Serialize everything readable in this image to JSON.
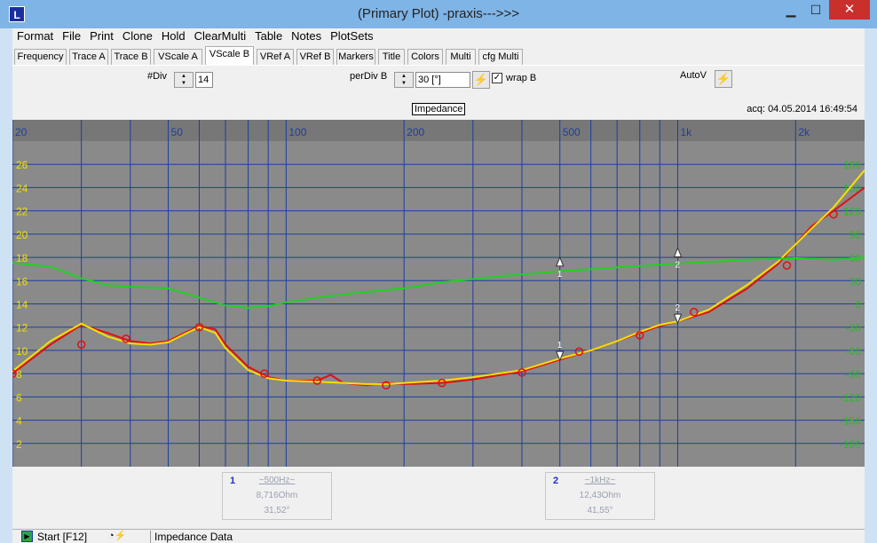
{
  "window": {
    "title": "(Primary Plot) -praxis--->>>",
    "app_icon_glyph": "L",
    "minimize_glyph": "▁",
    "maximize_glyph": "☐",
    "close_glyph": "✕"
  },
  "menu": [
    "Format",
    "File",
    "Print",
    "Clone",
    "Hold",
    "ClearMulti",
    "Table",
    "Notes",
    "PlotSets"
  ],
  "tabs": [
    "Frequency",
    "Trace A",
    "Trace B",
    "VScale A",
    "VScale B",
    "VRef A",
    "VRef B",
    "Markers",
    "Title",
    "Colors",
    "Multi",
    "cfg Multi"
  ],
  "active_tab": "VScale B",
  "controls": {
    "div_label": "#Div",
    "div_value": "14",
    "perdiv_label": "perDiv B",
    "perdiv_value": "30 [°]",
    "wrap_label": "wrap B",
    "wrap_checked": "✓",
    "autov_label": "AutoV",
    "apply_icon": "lightning-icon"
  },
  "plot": {
    "title": "Impedance",
    "acq": "acq: 04.05.2014 16:49:54",
    "bg": "#8a8a8a",
    "grid_color": "#1c3ea0"
  },
  "chart_data": {
    "type": "line",
    "x_scale": "log",
    "xlim": [
      20,
      3000
    ],
    "x_ticks": [
      {
        "v": 20,
        "label": "20"
      },
      {
        "v": 50,
        "label": "50"
      },
      {
        "v": 100,
        "label": "100"
      },
      {
        "v": 200,
        "label": "200"
      },
      {
        "v": 500,
        "label": "500"
      },
      {
        "v": 1000,
        "label": "1k"
      },
      {
        "v": 2000,
        "label": "2k"
      }
    ],
    "y_left": {
      "range": [
        0,
        28
      ],
      "labels": [
        2,
        4,
        6,
        8,
        10,
        12,
        14,
        16,
        18,
        20,
        22,
        24,
        26
      ],
      "color": "#f0e000"
    },
    "y_right": {
      "range": [
        -210,
        210
      ],
      "labels": [
        -180,
        -150,
        -120,
        -90,
        -60,
        -30,
        0,
        30,
        60,
        90,
        120,
        150,
        180
      ],
      "color": "#2db52d"
    },
    "series": [
      {
        "color": "#e01010",
        "axis": "left",
        "x": [
          20,
          25,
          30,
          35,
          40,
          45,
          50,
          55,
          60,
          66,
          70,
          80,
          90,
          100,
          120,
          130,
          140,
          160,
          180,
          200,
          250,
          300,
          400,
          500,
          600,
          700,
          800,
          900,
          1000,
          1200,
          1500,
          1800,
          2200,
          2500,
          3000
        ],
        "y": [
          8.0,
          10.5,
          12.2,
          11.5,
          10.8,
          10.6,
          10.8,
          11.5,
          12.1,
          11.8,
          10.5,
          8.6,
          7.7,
          7.4,
          7.4,
          7.9,
          7.2,
          7.0,
          7.2,
          7.1,
          7.2,
          7.5,
          8.2,
          9.2,
          10.0,
          10.8,
          11.5,
          12.1,
          12.5,
          13.3,
          15.3,
          17.4,
          20.7,
          22.0,
          24.0
        ]
      },
      {
        "color": "#f5e000",
        "axis": "left",
        "x": [
          20,
          25,
          30,
          35,
          40,
          45,
          50,
          55,
          60,
          66,
          70,
          80,
          90,
          100,
          120,
          140,
          160,
          180,
          200,
          250,
          300,
          400,
          500,
          600,
          700,
          800,
          900,
          1000,
          1200,
          1500,
          1800,
          2200,
          2500,
          3000
        ],
        "y": [
          8.2,
          10.8,
          12.3,
          11.2,
          10.6,
          10.5,
          10.7,
          11.4,
          12.0,
          11.5,
          10.2,
          8.3,
          7.6,
          7.4,
          7.3,
          7.2,
          7.1,
          7.1,
          7.2,
          7.4,
          7.7,
          8.3,
          9.3,
          10.0,
          10.8,
          11.6,
          12.2,
          12.5,
          13.5,
          15.6,
          17.6,
          20.5,
          22.3,
          25.5
        ]
      },
      {
        "color": "#22d022",
        "axis": "right",
        "x": [
          20,
          25,
          30,
          35,
          40,
          50,
          60,
          70,
          80,
          90,
          100,
          120,
          150,
          200,
          250,
          300,
          400,
          500,
          700,
          1000,
          1500,
          2000,
          2500,
          3000
        ],
        "y": [
          53,
          48,
          33,
          24,
          22,
          20,
          8,
          -2,
          -5,
          -3,
          2,
          8,
          14,
          20,
          28,
          32,
          38,
          42,
          47,
          52,
          57,
          59,
          57,
          60
        ]
      }
    ],
    "marker_points": [
      {
        "x": 20,
        "y": 8.0
      },
      {
        "x": 30,
        "y": 10.5
      },
      {
        "x": 39,
        "y": 11.0
      },
      {
        "x": 60,
        "y": 12.0
      },
      {
        "x": 88,
        "y": 8.0
      },
      {
        "x": 120,
        "y": 7.4
      },
      {
        "x": 180,
        "y": 7.0
      },
      {
        "x": 250,
        "y": 7.2
      },
      {
        "x": 400,
        "y": 8.1
      },
      {
        "x": 560,
        "y": 9.9
      },
      {
        "x": 800,
        "y": 11.3
      },
      {
        "x": 1100,
        "y": 13.3
      },
      {
        "x": 1900,
        "y": 17.3
      },
      {
        "x": 2500,
        "y": 21.7
      }
    ],
    "cursors": [
      {
        "label": "1",
        "x": 500,
        "up_y": 17.4,
        "down_y": 9.3
      },
      {
        "label": "2",
        "x": 1000,
        "up_y": 18.2,
        "down_y": 12.5
      }
    ]
  },
  "markers": [
    {
      "num": "1",
      "freq": "~500Hz~",
      "impedance": "8,716Ohm",
      "phase": "31,52°"
    },
    {
      "num": "2",
      "freq": "~1kHz~",
      "impedance": "12,43Ohm",
      "phase": "41,55°"
    }
  ],
  "status": {
    "start": "Start [F12]",
    "start_icon_glyph": "▶",
    "tools_glyph": "◔⚡",
    "text": "Impedance Data"
  }
}
